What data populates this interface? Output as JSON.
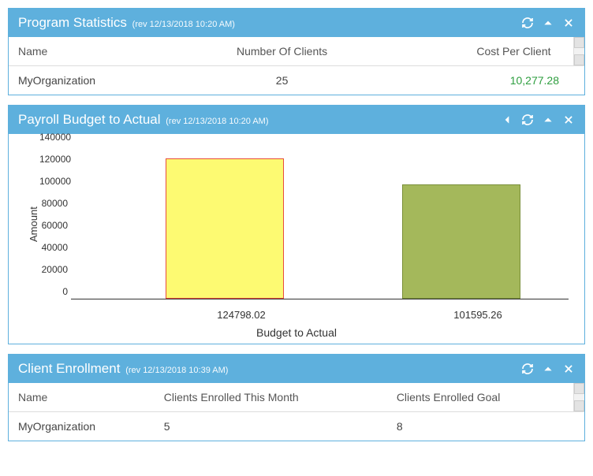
{
  "panels": {
    "stats": {
      "title": "Program Statistics",
      "rev": "(rev 12/13/2018 10:20 AM)",
      "columns": [
        "Name",
        "Number Of Clients",
        "Cost Per Client"
      ],
      "row": {
        "name": "MyOrganization",
        "clients": "25",
        "cost": "10,277.28"
      }
    },
    "payroll": {
      "title": "Payroll Budget to Actual",
      "rev": "(rev 12/13/2018 10:20 AM)"
    },
    "enroll": {
      "title": "Client Enrollment",
      "rev": "(rev 12/13/2018 10:39 AM)",
      "columns": [
        "Name",
        "Clients Enrolled This Month",
        "Clients Enrolled Goal"
      ],
      "row": {
        "name": "MyOrganization",
        "month": "5",
        "goal": "8"
      }
    }
  },
  "chart_data": {
    "type": "bar",
    "categories": [
      "124798.02",
      "101595.26"
    ],
    "values": [
      124798.02,
      101595.26
    ],
    "title": "",
    "xlabel": "Budget to Actual",
    "ylabel": "Amount",
    "ylim": [
      0,
      140000
    ],
    "yticks": [
      "0",
      "20000",
      "40000",
      "60000",
      "80000",
      "100000",
      "120000",
      "140000"
    ],
    "colors": [
      "#fdfa72",
      "#a4b85b"
    ]
  }
}
